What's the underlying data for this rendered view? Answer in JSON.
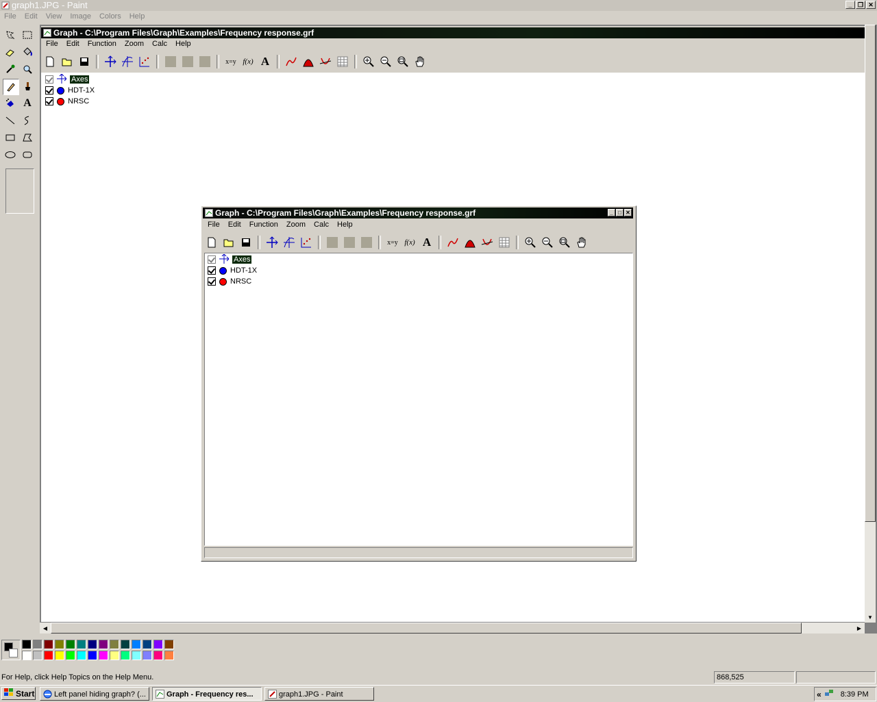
{
  "paint": {
    "title": "graph1.JPG - Paint",
    "menu": [
      "File",
      "Edit",
      "View",
      "Image",
      "Colors",
      "Help"
    ],
    "status_help": "For Help, click Help Topics on the Help Menu.",
    "coords": "868,525",
    "palette_top": [
      "#000000",
      "#808080",
      "#800000",
      "#808000",
      "#008000",
      "#008080",
      "#000080",
      "#800080",
      "#808040",
      "#004040",
      "#0080ff",
      "#004080",
      "#8000ff",
      "#804000"
    ],
    "palette_bottom": [
      "#ffffff",
      "#c0c0c0",
      "#ff0000",
      "#ffff00",
      "#00ff00",
      "#00ffff",
      "#0000ff",
      "#ff00ff",
      "#ffff80",
      "#00ff80",
      "#80ffff",
      "#8080ff",
      "#ff0080",
      "#ff8040"
    ]
  },
  "graph_big": {
    "title": "Graph - C:\\Program Files\\Graph\\Examples\\Frequency response.grf",
    "menu": [
      "File",
      "Edit",
      "Function",
      "Zoom",
      "Calc",
      "Help"
    ],
    "items": [
      {
        "label": "Axes",
        "checked": true,
        "dim": true
      },
      {
        "label": "HDT-1X",
        "checked": true,
        "color": "#0000ff"
      },
      {
        "label": "NRSC",
        "checked": true,
        "color": "#ff0000"
      }
    ]
  },
  "graph_small": {
    "title": "Graph - C:\\Program Files\\Graph\\Examples\\Frequency response.grf",
    "menu": [
      "File",
      "Edit",
      "Function",
      "Zoom",
      "Calc",
      "Help"
    ],
    "items": [
      {
        "label": "Axes",
        "checked": true,
        "dim": true
      },
      {
        "label": "HDT-1X",
        "checked": true,
        "color": "#0000ff"
      },
      {
        "label": "NRSC",
        "checked": true,
        "color": "#ff0000"
      }
    ]
  },
  "toolbar": {
    "xy_label": "x=y",
    "fx_label": "f(x)",
    "text_label": "A"
  },
  "taskbar": {
    "start": "Start",
    "buttons": [
      "Left panel hiding graph? (...",
      "Graph - Frequency res...",
      "graph1.JPG - Paint"
    ],
    "tray_arrow": "«",
    "clock": "8:39 PM"
  },
  "colors": {
    "blue_icon": "#0000c0",
    "red_icon": "#d00000"
  }
}
